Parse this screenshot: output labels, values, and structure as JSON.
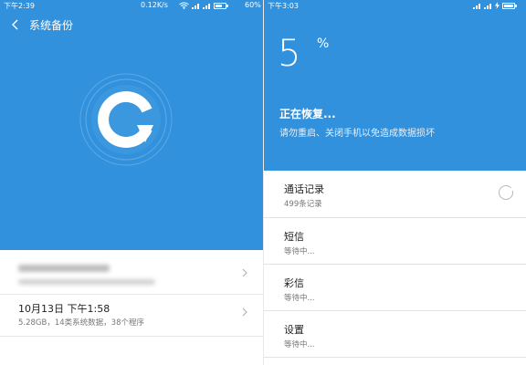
{
  "left": {
    "status": {
      "time": "下午2:39",
      "speed": "0.12K/s",
      "battery": "60%",
      "battery_level": 0.6
    },
    "header": {
      "title": "系统备份",
      "back_icon": "chevron-left-icon"
    },
    "logo": {
      "icon": "backup-restore-logo-icon",
      "color": "#ffffff"
    },
    "backups": [
      {
        "date": "10月13日 下午1:58",
        "details": "5.28GB，14类系统数据，38个程序"
      }
    ]
  },
  "right": {
    "status": {
      "time": "下午3:03"
    },
    "progress": {
      "percent": "5",
      "percent_sign": "%",
      "value": 0.05
    },
    "restoring_title": "正在恢复...",
    "warning": "请勿重启、关闭手机以免造成数据损坏",
    "items": [
      {
        "name": "通话记录",
        "status": "499条记录",
        "state": "in-progress"
      },
      {
        "name": "短信",
        "status": "等待中..."
      },
      {
        "name": "彩信",
        "status": "等待中..."
      },
      {
        "name": "设置",
        "status": "等待中..."
      }
    ]
  },
  "colors": {
    "primary_blue": "#3191dc",
    "background": "#ffffff"
  }
}
